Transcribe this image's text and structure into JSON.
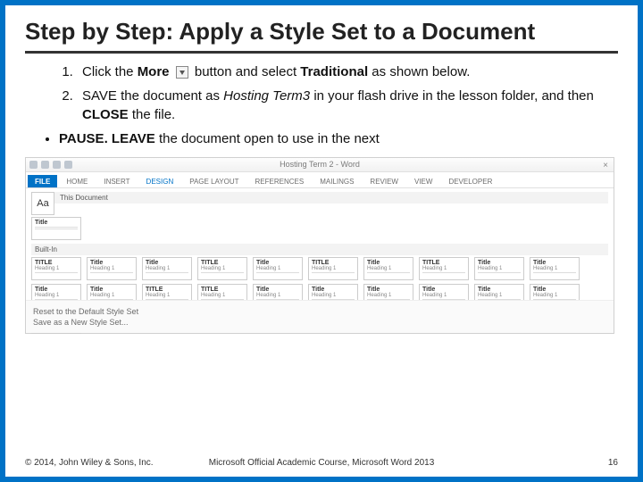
{
  "title": "Step by Step: Apply a Style Set to a Document",
  "steps": {
    "s1a": "Click the ",
    "s1_more": "More",
    "s1b": " button and select ",
    "s1_trad": "Traditional",
    "s1c": " as shown below.",
    "s2a": " SAVE the document as ",
    "s2_name": "Hosting Term3",
    "s2b": " in your flash drive in the lesson folder, and then ",
    "s2_close": "CLOSE",
    "s2c": " the file."
  },
  "pause": {
    "p1": "PAUSE. LEAVE",
    "p2": " the document open to use in the next"
  },
  "word": {
    "title": "Hosting Term 2 - Word",
    "tabs": [
      "FILE",
      "HOME",
      "INSERT",
      "DESIGN",
      "PAGE LAYOUT",
      "REFERENCES",
      "MAILINGS",
      "REVIEW",
      "VIEW",
      "DEVELOPER"
    ],
    "aa": "Aa",
    "thisdoc": "This Document",
    "builtin": "Built-In",
    "thumbs": {
      "title_label": "Title",
      "TITLE_label": "TITLE",
      "heading": "Heading 1"
    },
    "links": {
      "reset": "Reset to the Default Style Set",
      "saveas": "Save as a New Style Set..."
    }
  },
  "footer": {
    "left": "© 2014, John Wiley & Sons, Inc.",
    "center": "Microsoft Official Academic Course, Microsoft Word 2013",
    "right": "16"
  }
}
